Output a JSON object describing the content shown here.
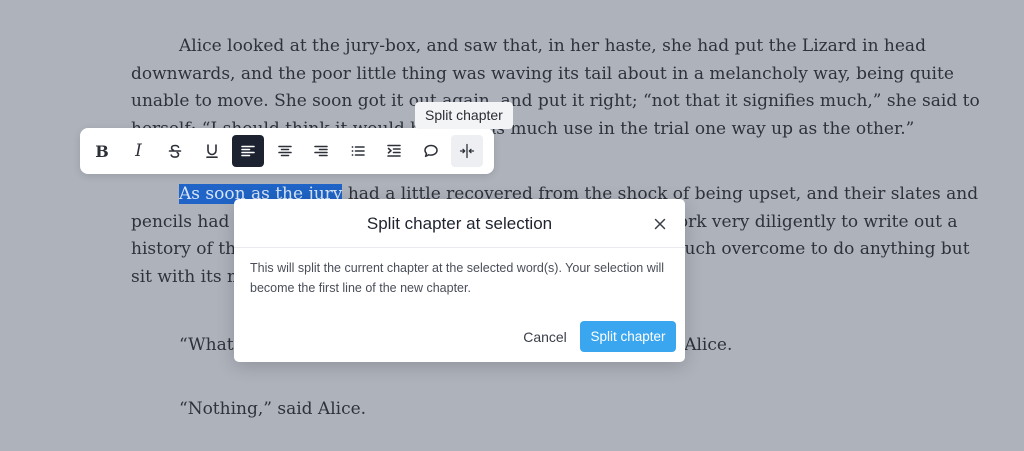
{
  "editor": {
    "p1": "Alice looked at the jury-box, and saw that, in her haste, she had put the Lizard in head downwards, and the poor little thing was waving its tail about in a melancholy way, being quite unable to move. She soon got it out again, and put it right; “not that it signifies much,” she said to herself; “I should think it would be quite as much use in the trial one way up as the other.”",
    "p2_selected": "As soon as the jury",
    "p2_rest": " had a little recovered from the shock of being upset, and their slates and pencils had been found and handed back to them, they set to work very diligently to write out a history of the accident, all except the Lizard, who seemed too much overcome to do anything but sit with its mouth open, gazing up into the roof of the court.",
    "p3": "“What do you know about this business?” the King said to Alice.",
    "p4": "“Nothing,” said Alice."
  },
  "tooltip": {
    "text": "Split chapter"
  },
  "toolbar": {
    "bold": "B",
    "italic": "I",
    "icons": [
      "strikethrough-icon",
      "underline-icon",
      "align-left-icon",
      "align-center-icon",
      "align-right-icon",
      "bullet-list-icon",
      "indent-icon",
      "comment-icon",
      "split-chapter-icon"
    ],
    "active": "align-left"
  },
  "modal": {
    "title": "Split chapter at selection",
    "body": "This will split the current chapter at the selected word(s). Your selection will become the first line of the new chapter.",
    "cancel_label": "Cancel",
    "confirm_label": "Split chapter"
  },
  "colors": {
    "overlay": "#aeb2bb",
    "selection": "#1f64c6",
    "primary_button": "#3aa6ef",
    "active_tool": "#1d2230"
  }
}
